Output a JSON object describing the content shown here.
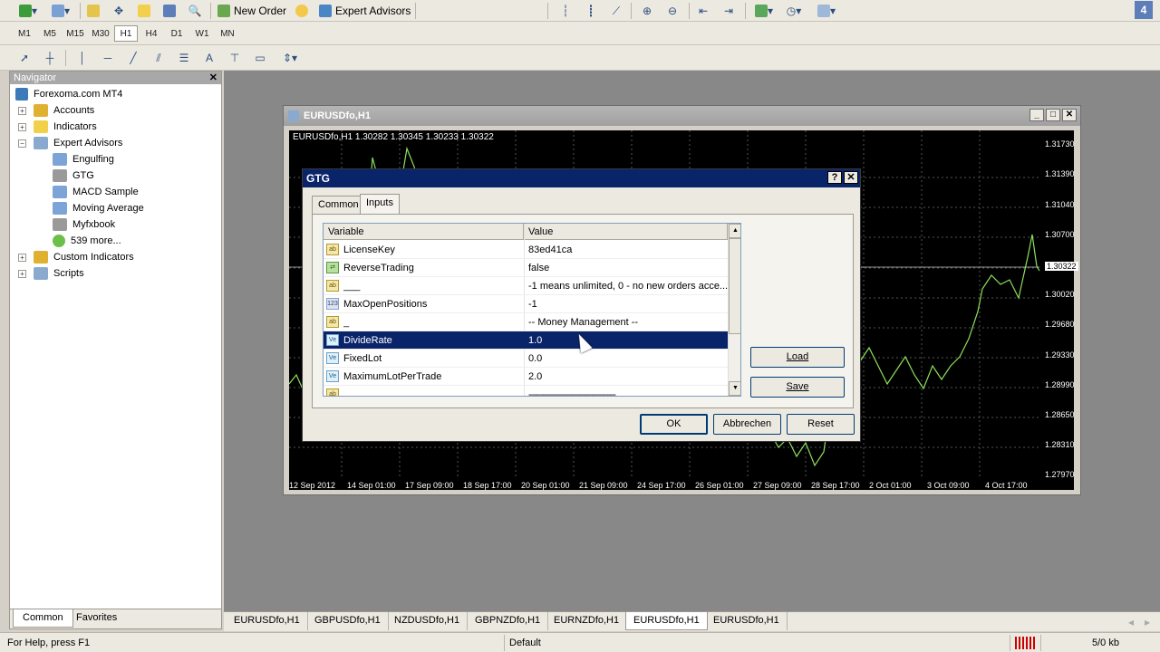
{
  "toolbar": {
    "new_order": "New Order",
    "expert_advisors": "Expert Advisors",
    "corner_badge": "4"
  },
  "timeframes": [
    "M1",
    "M5",
    "M15",
    "M30",
    "H1",
    "H4",
    "D1",
    "W1",
    "MN"
  ],
  "active_timeframe": "H1",
  "navigator": {
    "title": "Navigator",
    "close": "✕",
    "root": "Forexoma.com MT4",
    "items": [
      {
        "label": "Accounts"
      },
      {
        "label": "Indicators"
      },
      {
        "label": "Expert Advisors"
      },
      {
        "label": "Engulfing"
      },
      {
        "label": "GTG"
      },
      {
        "label": "MACD Sample"
      },
      {
        "label": "Moving Average"
      },
      {
        "label": "Myfxbook"
      },
      {
        "label": "539 more..."
      },
      {
        "label": "Custom Indicators"
      },
      {
        "label": "Scripts"
      }
    ],
    "tabs": [
      "Common",
      "Favorites"
    ]
  },
  "chart_window": {
    "title": "EURUSDfo,H1",
    "info": "EURUSDfo,H1  1.30282 1.30345 1.30233 1.30322",
    "price_labels": [
      "1.31730",
      "1.31390",
      "1.31040",
      "1.30700",
      "1.30322",
      "1.30020",
      "1.29680",
      "1.29330",
      "1.28990",
      "1.28650",
      "1.28310",
      "1.27970"
    ],
    "time_labels": [
      "12 Sep 2012",
      "14 Sep 01:00",
      "17 Sep 09:00",
      "18 Sep 17:00",
      "20 Sep 01:00",
      "21 Sep 09:00",
      "24 Sep 17:00",
      "26 Sep 01:00",
      "27 Sep 09:00",
      "28 Sep 17:00",
      "2 Oct 01:00",
      "3 Oct 09:00",
      "4 Oct 17:00"
    ]
  },
  "dialog": {
    "title": "GTG",
    "help": "?",
    "close": "✕",
    "tabs": [
      "Common",
      "Inputs"
    ],
    "columns": [
      "Variable",
      "Value"
    ],
    "rows": [
      {
        "icon": "ab",
        "variable": "LicenseKey",
        "value": "83ed41ca"
      },
      {
        "icon": "bool",
        "variable": "ReverseTrading",
        "value": "false"
      },
      {
        "icon": "ab",
        "variable": "___",
        "value": "-1 means unlimited, 0 - no new orders acce..."
      },
      {
        "icon": "123",
        "variable": "MaxOpenPositions",
        "value": "-1"
      },
      {
        "icon": "ab",
        "variable": "_",
        "value": "-- Money Management --"
      },
      {
        "icon": "Ve",
        "variable": "DivideRate",
        "value": "1.0"
      },
      {
        "icon": "Ve",
        "variable": "FixedLot",
        "value": "0.0"
      },
      {
        "icon": "Ve",
        "variable": "MaximumLotPerTrade",
        "value": "2.0"
      },
      {
        "icon": "ab",
        "variable": "",
        "value": "------------------------------------"
      }
    ],
    "selected_row": 5,
    "load": "Load",
    "save": "Save",
    "ok": "OK",
    "cancel": "Abbrechen",
    "reset": "Reset"
  },
  "window_tabs": [
    "EURUSDfo,H1",
    "GBPUSDfo,H1",
    "NZDUSDfo,H1",
    "GBPNZDfo,H1",
    "EURNZDfo,H1",
    "EURUSDfo,H1",
    "EURUSDfo,H1"
  ],
  "status": {
    "help": "For Help, press F1",
    "profile": "Default",
    "traffic": "5/0 kb"
  }
}
